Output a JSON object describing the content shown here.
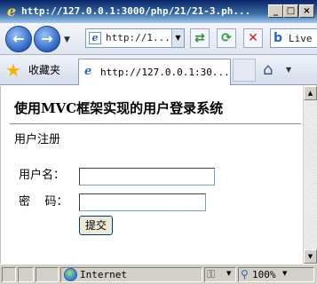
{
  "window": {
    "title": "http://127.0.0.1:3000/php/21/21-3.ph...",
    "minimize_glyph": "_",
    "maximize_glyph": "□",
    "close_glyph": "×"
  },
  "nav": {
    "back_glyph": "←",
    "forward_glyph": "→",
    "dropdown_glyph": "▼",
    "address_url": "http://1...",
    "compat_glyph": "⇄",
    "refresh_glyph": "⟳",
    "stop_glyph": "✕",
    "search_brand": "b",
    "search_text": "Live"
  },
  "tabs": {
    "favorites_label": "收藏夹",
    "active_tab_label": "http://127.0.0.1:30...",
    "home_glyph": "⌂"
  },
  "page": {
    "title": "使用MVC框架实现的用户登录系统",
    "subtitle": "用户注册",
    "username_label": "用户名：",
    "password_label": "密    码：",
    "username_value": "",
    "password_value": "",
    "submit_label": "提交"
  },
  "status": {
    "zone": "Internet",
    "zoom": "100%"
  },
  "colors": {
    "titlebar": "#0a246a",
    "chrome": "#d4d0c8",
    "accent": "#2a64c4"
  }
}
